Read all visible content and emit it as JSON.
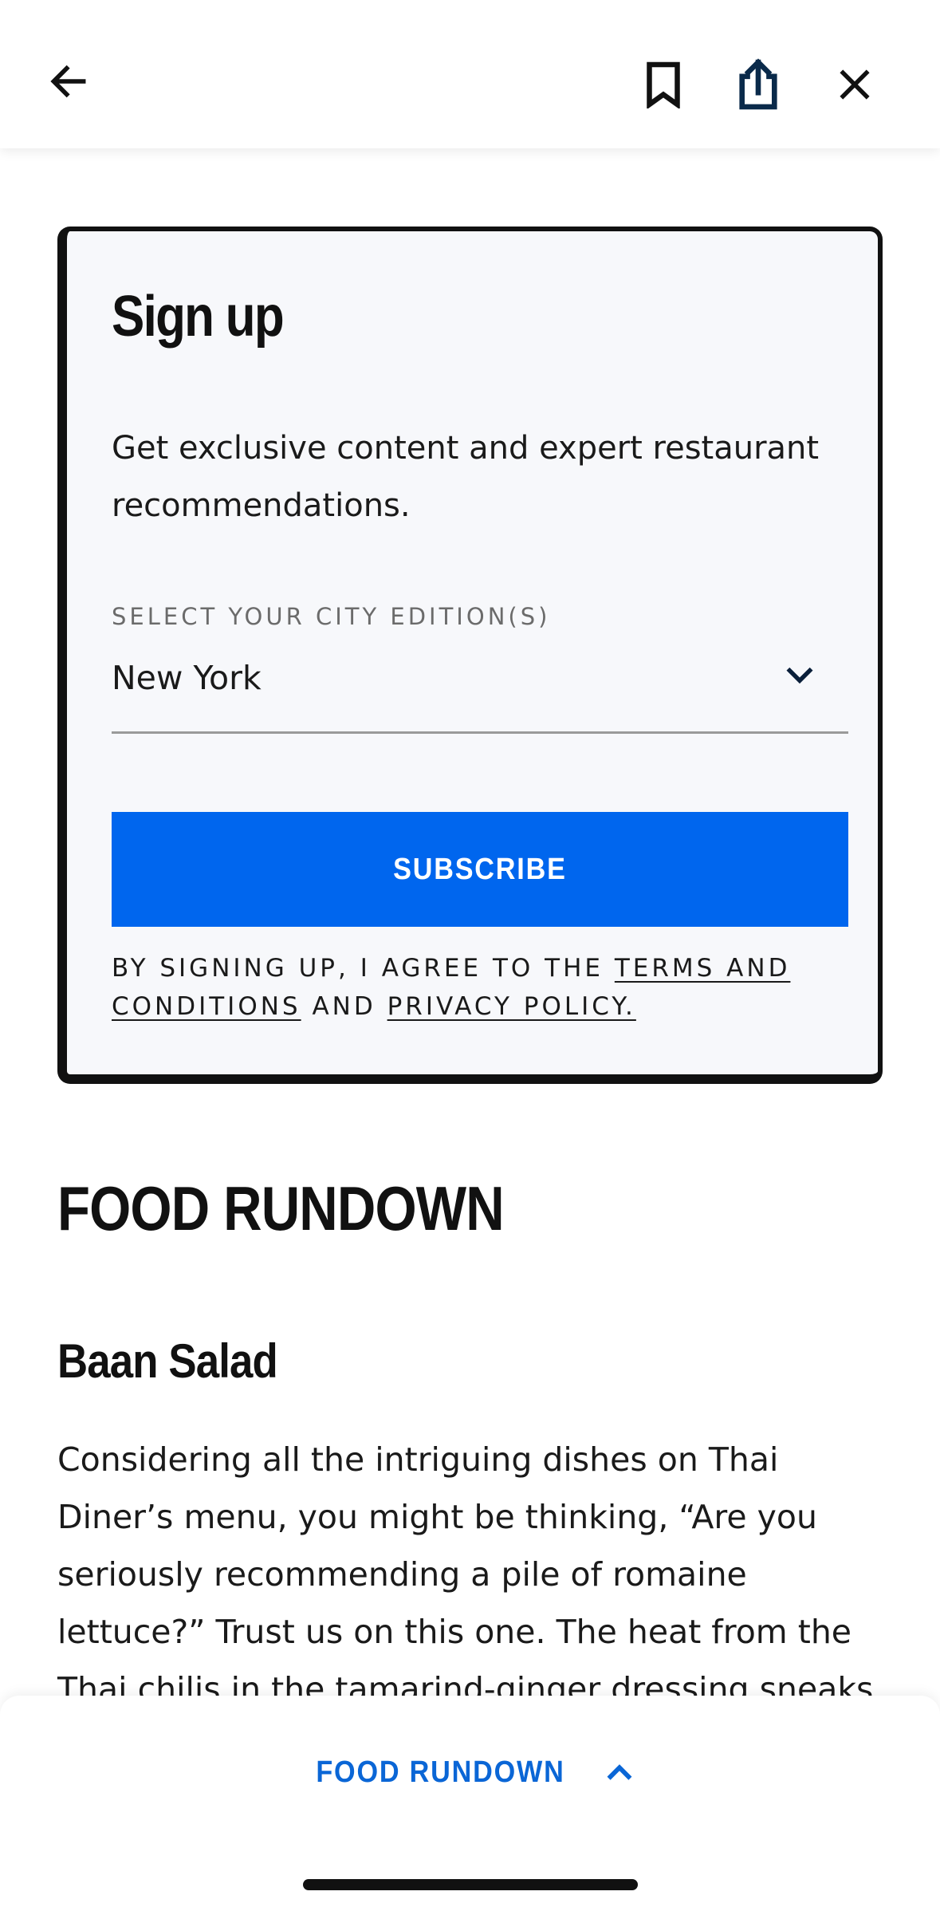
{
  "toolbar": {
    "back_icon": "arrow-left-icon",
    "bookmark_icon": "bookmark-icon",
    "share_icon": "share-icon",
    "close_icon": "close-icon"
  },
  "signup": {
    "title": "Sign up",
    "description": "Get exclusive content and expert restaurant recommendations.",
    "city_label": "SELECT YOUR CITY EDITION(S)",
    "city_value": "New York",
    "subscribe_label": "SUBSCRIBE",
    "legal_prefix": "BY SIGNING UP, I AGREE TO THE ",
    "terms_link": "TERMS AND CONDITIONS",
    "legal_middle": " AND ",
    "privacy_link": "PRIVACY POLICY."
  },
  "article": {
    "section_heading": "FOOD RUNDOWN",
    "item_heading": "Baan Salad",
    "item_body": "Considering all the intriguing dishes on Thai Diner’s menu, you might be thinking, “Are you seriously recommending a pile of romaine lettuce?” Trust us on this one. The heat from the Thai chilis in the tamarind-ginger dressing sneaks up on you. That"
  },
  "bottom_bar": {
    "jump_label": "FOOD RUNDOWN"
  },
  "colors": {
    "accent": "#0066ee",
    "link_blue": "#0a66d6",
    "card_border": "#111111",
    "card_background": "#f7f8fb"
  }
}
